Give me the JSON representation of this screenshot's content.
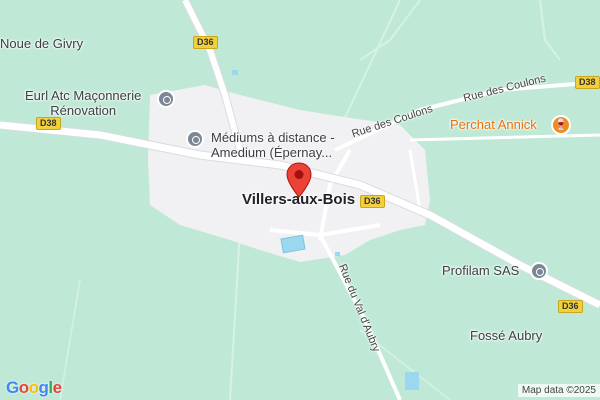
{
  "map": {
    "town": "Villers-aux-Bois",
    "places": {
      "noue_de_givry": "Noue de Givry",
      "mediums_line1": "Médiums à distance -",
      "mediums_line2": "Amedium (Épernay...",
      "eurl_line1": "Eurl Atc Maçonnerie",
      "eurl_line2": "Rénovation",
      "perchat": "Perchat Annick",
      "profilam": "Profilam SAS",
      "fosse_aubry": "Fossé Aubry"
    },
    "roads": {
      "coulons_1": "Rue des Coulons",
      "coulons_2": "Rue des Coulons",
      "val_daubry": "Rue du Val d'Aubry"
    },
    "shields": {
      "d36_top": "D36",
      "d38_left": "D38",
      "d36_center": "D36",
      "d38_right": "D38",
      "d36_right": "D36"
    },
    "icons": {
      "poi": "place-icon",
      "restaurant": "restaurant-icon",
      "pin": "map-pin-icon"
    }
  },
  "branding": {
    "logo": "Google",
    "attribution": "Map data ©2025"
  },
  "colors": {
    "land": "#bfe9d6",
    "urban": "#f1f1f3",
    "road": "#ffffff",
    "pin": "#ea4335",
    "shield": "#f2d03b",
    "restaurant": "#f08a24",
    "water": "#9bd7ef"
  }
}
